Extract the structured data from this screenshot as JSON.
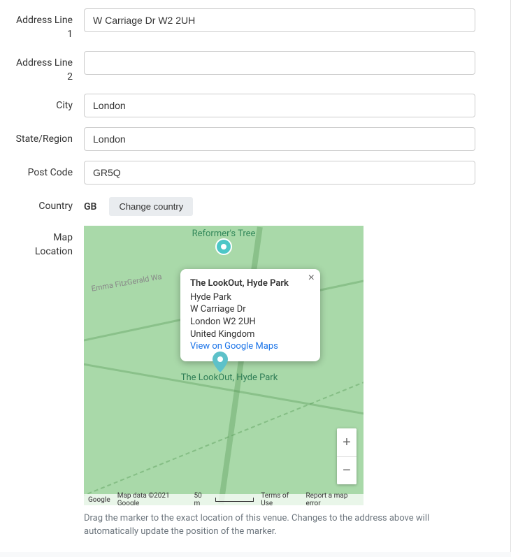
{
  "fields": {
    "address1": {
      "label": "Address Line 1",
      "value": "W Carriage Dr W2 2UH"
    },
    "address2": {
      "label": "Address Line 2",
      "value": ""
    },
    "city": {
      "label": "City",
      "value": "London"
    },
    "state": {
      "label": "State/Region",
      "value": "London"
    },
    "postcode": {
      "label": "Post Code",
      "value": "GR5Q"
    },
    "country": {
      "label": "Country",
      "value": "GB",
      "change_btn": "Change country"
    },
    "map": {
      "label": "Map Location"
    }
  },
  "map": {
    "top_feature_label": "Reformer's Tree",
    "road_label": "Emma FitzGerald Wa",
    "poi_label": "The LookOut, Hyde Park",
    "info_window": {
      "title": "The LookOut, Hyde Park",
      "lines": [
        "Hyde Park",
        "W Carriage Dr",
        "London W2 2UH",
        "United Kingdom"
      ],
      "link_text": "View on Google Maps"
    },
    "zoom_in": "+",
    "zoom_out": "−",
    "footer": {
      "logo": "Google",
      "copyright": "Map data ©2021 Google",
      "scale": "50 m",
      "terms": "Terms of Use",
      "report": "Report a map error"
    },
    "help_text": "Drag the marker to the exact location of this venue. Changes to the address above will automatically update the position of the marker."
  }
}
